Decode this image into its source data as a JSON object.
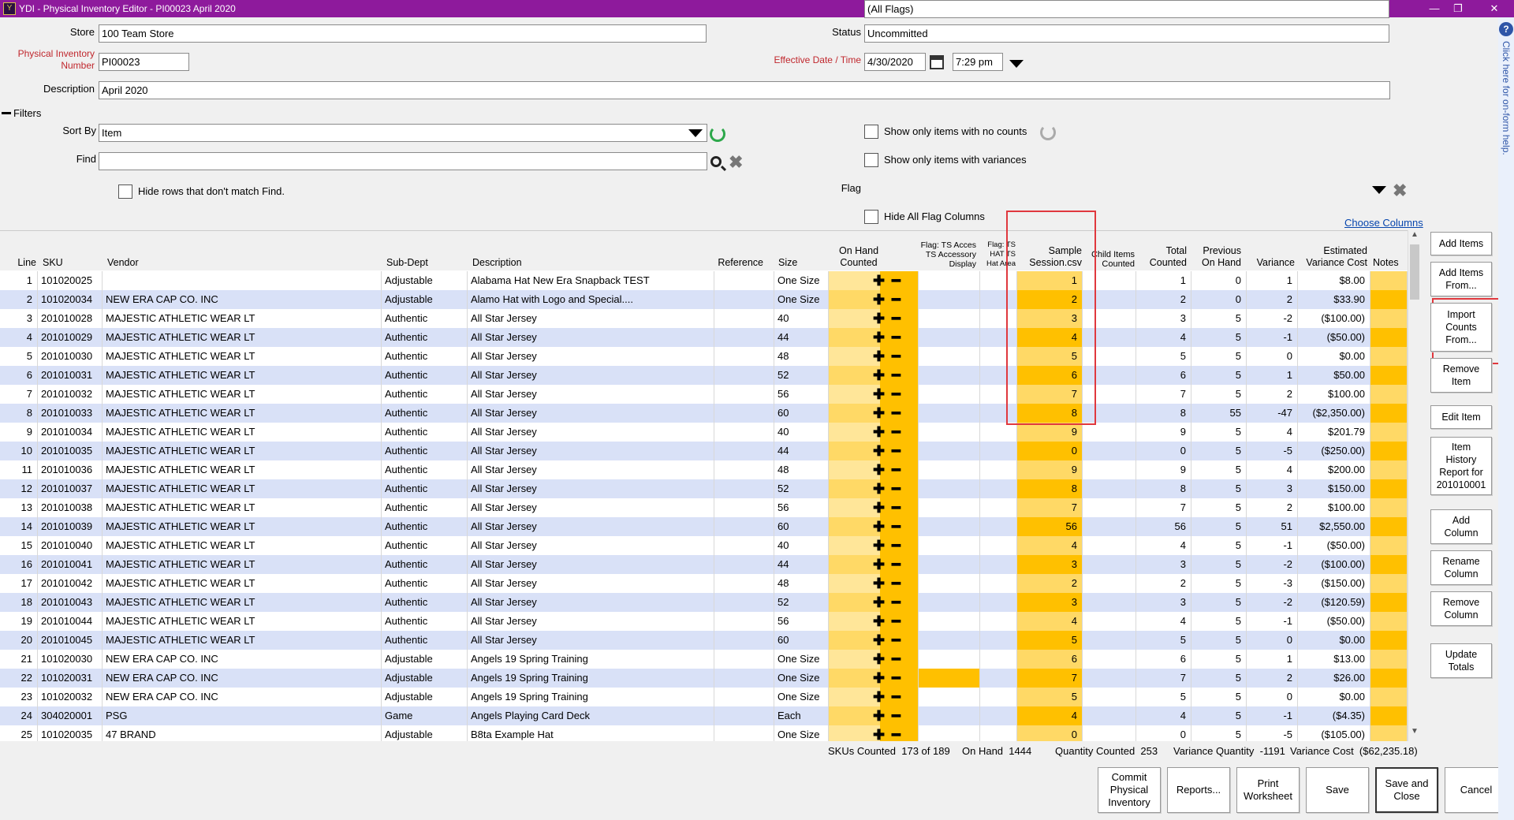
{
  "window": {
    "title": "YDI - Physical Inventory Editor - PI00023 April 2020"
  },
  "form": {
    "store_label": "Store",
    "store_value": "100 Team Store",
    "status_label": "Status",
    "status_value": "Uncommitted",
    "pi_label_1": "Physical Inventory",
    "pi_label_2": "Number",
    "pi_value": "PI00023",
    "effective_label": "Effective Date / Time",
    "date_value": "4/30/2020",
    "time_value": "7:29 pm",
    "description_label": "Description",
    "description_value": "April 2020"
  },
  "filters": {
    "title": "Filters",
    "sort_label": "Sort By",
    "sort_value": "Item",
    "find_label": "Find",
    "find_value": "",
    "hide_rows_label": "Hide rows that don't match Find.",
    "no_counts_label": "Show only items with no counts",
    "variances_label": "Show only items with variances",
    "flag_label": "Flag",
    "flag_value": "(All Flags)",
    "hide_flags_label": "Hide All Flag Columns",
    "choose_columns": "Choose Columns"
  },
  "columns": {
    "line": "Line",
    "sku": "SKU",
    "vendor": "Vendor",
    "subdept": "Sub-Dept",
    "description": "Description",
    "reference": "Reference",
    "size": "Size",
    "onhand_1": "On Hand",
    "onhand_2": "Counted",
    "flag1_1": "Flag: TS Acces",
    "flag1_2": "TS Accessory",
    "flag1_3": "Display",
    "flag2_1": "Flag: TS",
    "flag2_2": "HAT TS",
    "flag2_3": "Hat Area",
    "sample_1": "Sample",
    "sample_2": "Session.csv",
    "child_1": "Child Items",
    "child_2": "Counted",
    "total_1": "Total",
    "total_2": "Counted",
    "prev_1": "Previous",
    "prev_2": "On Hand",
    "variance": "Variance",
    "estcost_1": "Estimated",
    "estcost_2": "Variance Cost",
    "notes": "Notes"
  },
  "rows": [
    {
      "line": "1",
      "sku": "101020025",
      "vendor": "",
      "subdept": "Adjustable",
      "description": "Alabama Hat New Era Snapback TEST",
      "size": "One Size",
      "sample": "1",
      "total": "1",
      "prev": "0",
      "variance": "1",
      "cost": "$8.00"
    },
    {
      "line": "2",
      "sku": "101020034",
      "vendor": "NEW ERA CAP CO. INC",
      "subdept": "Adjustable",
      "description": "Alamo Hat with Logo and Special....",
      "size": "One Size",
      "sample": "2",
      "total": "2",
      "prev": "0",
      "variance": "2",
      "cost": "$33.90"
    },
    {
      "line": "3",
      "sku": "201010028",
      "vendor": "MAJESTIC ATHLETIC WEAR LT",
      "subdept": "Authentic",
      "description": "All Star Jersey",
      "size": "40",
      "sample": "3",
      "total": "3",
      "prev": "5",
      "variance": "-2",
      "cost": "($100.00)"
    },
    {
      "line": "4",
      "sku": "201010029",
      "vendor": "MAJESTIC ATHLETIC WEAR LT",
      "subdept": "Authentic",
      "description": "All Star Jersey",
      "size": "44",
      "sample": "4",
      "total": "4",
      "prev": "5",
      "variance": "-1",
      "cost": "($50.00)"
    },
    {
      "line": "5",
      "sku": "201010030",
      "vendor": "MAJESTIC ATHLETIC WEAR LT",
      "subdept": "Authentic",
      "description": "All Star Jersey",
      "size": "48",
      "sample": "5",
      "total": "5",
      "prev": "5",
      "variance": "0",
      "cost": "$0.00"
    },
    {
      "line": "6",
      "sku": "201010031",
      "vendor": "MAJESTIC ATHLETIC WEAR LT",
      "subdept": "Authentic",
      "description": "All Star Jersey",
      "size": "52",
      "sample": "6",
      "total": "6",
      "prev": "5",
      "variance": "1",
      "cost": "$50.00"
    },
    {
      "line": "7",
      "sku": "201010032",
      "vendor": "MAJESTIC ATHLETIC WEAR LT",
      "subdept": "Authentic",
      "description": "All Star Jersey",
      "size": "56",
      "sample": "7",
      "total": "7",
      "prev": "5",
      "variance": "2",
      "cost": "$100.00"
    },
    {
      "line": "8",
      "sku": "201010033",
      "vendor": "MAJESTIC ATHLETIC WEAR LT",
      "subdept": "Authentic",
      "description": "All Star Jersey",
      "size": "60",
      "sample": "8",
      "total": "8",
      "prev": "55",
      "variance": "-47",
      "cost": "($2,350.00)"
    },
    {
      "line": "9",
      "sku": "201010034",
      "vendor": "MAJESTIC ATHLETIC WEAR LT",
      "subdept": "Authentic",
      "description": "All Star Jersey",
      "size": "40",
      "sample": "9",
      "total": "9",
      "prev": "5",
      "variance": "4",
      "cost": "$201.79"
    },
    {
      "line": "10",
      "sku": "201010035",
      "vendor": "MAJESTIC ATHLETIC WEAR LT",
      "subdept": "Authentic",
      "description": "All Star Jersey",
      "size": "44",
      "sample": "0",
      "total": "0",
      "prev": "5",
      "variance": "-5",
      "cost": "($250.00)"
    },
    {
      "line": "11",
      "sku": "201010036",
      "vendor": "MAJESTIC ATHLETIC WEAR LT",
      "subdept": "Authentic",
      "description": "All Star Jersey",
      "size": "48",
      "sample": "9",
      "total": "9",
      "prev": "5",
      "variance": "4",
      "cost": "$200.00"
    },
    {
      "line": "12",
      "sku": "201010037",
      "vendor": "MAJESTIC ATHLETIC WEAR LT",
      "subdept": "Authentic",
      "description": "All Star Jersey",
      "size": "52",
      "sample": "8",
      "total": "8",
      "prev": "5",
      "variance": "3",
      "cost": "$150.00"
    },
    {
      "line": "13",
      "sku": "201010038",
      "vendor": "MAJESTIC ATHLETIC WEAR LT",
      "subdept": "Authentic",
      "description": "All Star Jersey",
      "size": "56",
      "sample": "7",
      "total": "7",
      "prev": "5",
      "variance": "2",
      "cost": "$100.00"
    },
    {
      "line": "14",
      "sku": "201010039",
      "vendor": "MAJESTIC ATHLETIC WEAR LT",
      "subdept": "Authentic",
      "description": "All Star Jersey",
      "size": "60",
      "sample": "56",
      "total": "56",
      "prev": "5",
      "variance": "51",
      "cost": "$2,550.00"
    },
    {
      "line": "15",
      "sku": "201010040",
      "vendor": "MAJESTIC ATHLETIC WEAR LT",
      "subdept": "Authentic",
      "description": "All Star Jersey",
      "size": "40",
      "sample": "4",
      "total": "4",
      "prev": "5",
      "variance": "-1",
      "cost": "($50.00)"
    },
    {
      "line": "16",
      "sku": "201010041",
      "vendor": "MAJESTIC ATHLETIC WEAR LT",
      "subdept": "Authentic",
      "description": "All Star Jersey",
      "size": "44",
      "sample": "3",
      "total": "3",
      "prev": "5",
      "variance": "-2",
      "cost": "($100.00)"
    },
    {
      "line": "17",
      "sku": "201010042",
      "vendor": "MAJESTIC ATHLETIC WEAR LT",
      "subdept": "Authentic",
      "description": "All Star Jersey",
      "size": "48",
      "sample": "2",
      "total": "2",
      "prev": "5",
      "variance": "-3",
      "cost": "($150.00)"
    },
    {
      "line": "18",
      "sku": "201010043",
      "vendor": "MAJESTIC ATHLETIC WEAR LT",
      "subdept": "Authentic",
      "description": "All Star Jersey",
      "size": "52",
      "sample": "3",
      "total": "3",
      "prev": "5",
      "variance": "-2",
      "cost": "($120.59)"
    },
    {
      "line": "19",
      "sku": "201010044",
      "vendor": "MAJESTIC ATHLETIC WEAR LT",
      "subdept": "Authentic",
      "description": "All Star Jersey",
      "size": "56",
      "sample": "4",
      "total": "4",
      "prev": "5",
      "variance": "-1",
      "cost": "($50.00)"
    },
    {
      "line": "20",
      "sku": "201010045",
      "vendor": "MAJESTIC ATHLETIC WEAR LT",
      "subdept": "Authentic",
      "description": "All Star Jersey",
      "size": "60",
      "sample": "5",
      "total": "5",
      "prev": "5",
      "variance": "0",
      "cost": "$0.00"
    },
    {
      "line": "21",
      "sku": "101020030",
      "vendor": "NEW ERA CAP CO. INC",
      "subdept": "Adjustable",
      "description": "Angels 19 Spring Training",
      "size": "One Size",
      "sample": "6",
      "total": "6",
      "prev": "5",
      "variance": "1",
      "cost": "$13.00"
    },
    {
      "line": "22",
      "sku": "101020031",
      "vendor": "NEW ERA CAP CO. INC",
      "subdept": "Adjustable",
      "description": "Angels 19 Spring Training",
      "size": "One Size",
      "sample": "7",
      "total": "7",
      "prev": "5",
      "variance": "2",
      "cost": "$26.00"
    },
    {
      "line": "23",
      "sku": "101020032",
      "vendor": "NEW ERA CAP CO. INC",
      "subdept": "Adjustable",
      "description": "Angels 19 Spring Training",
      "size": "One Size",
      "sample": "5",
      "total": "5",
      "prev": "5",
      "variance": "0",
      "cost": "$0.00"
    },
    {
      "line": "24",
      "sku": "304020001",
      "vendor": "PSG",
      "subdept": "Game",
      "description": "Angels Playing Card Deck",
      "size": "Each",
      "sample": "4",
      "total": "4",
      "prev": "5",
      "variance": "-1",
      "cost": "($4.35)"
    },
    {
      "line": "25",
      "sku": "101020035",
      "vendor": "47 BRAND",
      "subdept": "Adjustable",
      "description": "B8ta Example Hat",
      "size": "One Size",
      "sample": "0",
      "total": "0",
      "prev": "5",
      "variance": "-5",
      "cost": "($105.00)"
    }
  ],
  "summary": {
    "skus_label": "SKUs Counted",
    "skus_value": "173 of 189",
    "onhand_label": "On Hand",
    "onhand_value": "1444",
    "qty_label": "Quantity Counted",
    "qty_value": "253",
    "varqty_label": "Variance Quantity",
    "varqty_value": "-1191",
    "varcost_label": "Variance Cost",
    "varcost_value": "($62,235.18)"
  },
  "side_buttons": {
    "add_items": "Add Items",
    "add_items_from_1": "Add Items",
    "add_items_from_2": "From...",
    "import_1": "Import",
    "import_2": "Counts",
    "import_3": "From...",
    "remove_item_1": "Remove",
    "remove_item_2": "Item",
    "edit_item": "Edit Item",
    "history_1": "Item",
    "history_2": "History",
    "history_3": "Report for",
    "history_4": "201010001",
    "add_col_1": "Add",
    "add_col_2": "Column",
    "rename_col_1": "Rename",
    "rename_col_2": "Column",
    "remove_col_1": "Remove",
    "remove_col_2": "Column",
    "update_1": "Update",
    "update_2": "Totals"
  },
  "bottom_buttons": {
    "commit_1": "Commit",
    "commit_2": "Physical",
    "commit_3": "Inventory",
    "reports": "Reports...",
    "print_1": "Print",
    "print_2": "Worksheet",
    "save": "Save",
    "save_close_1": "Save and",
    "save_close_2": "Close",
    "cancel": "Cancel"
  },
  "help": {
    "text": "Click here for on-form help."
  },
  "colors": {
    "titlebar": "#8e1a9c",
    "count_yellow": "#ffd966",
    "count_orange": "#ffc000",
    "row_alt": "#d9e1f7",
    "highlight": "#e0383e"
  }
}
